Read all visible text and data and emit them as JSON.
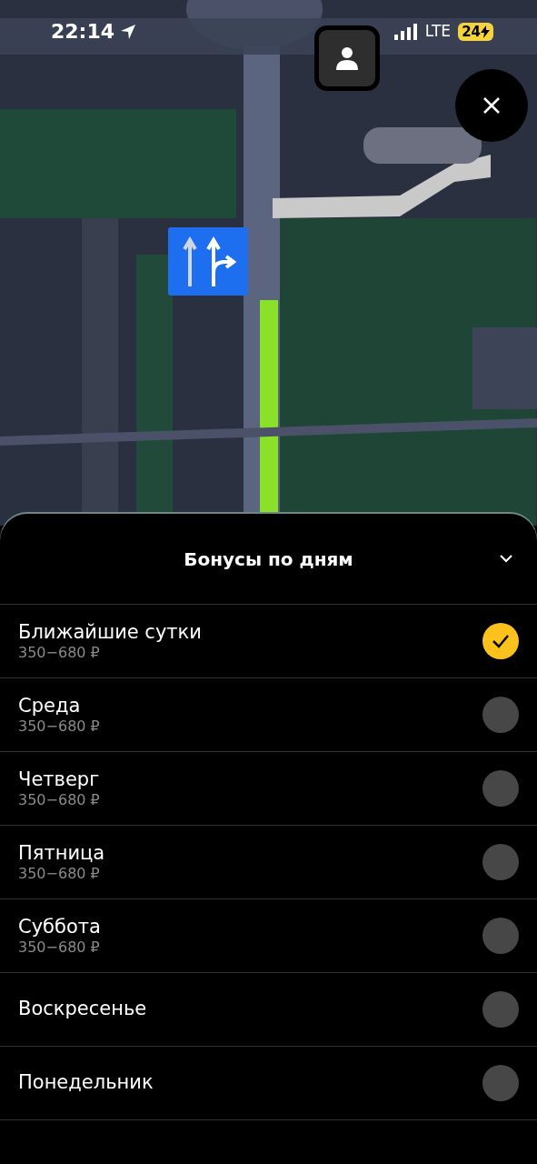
{
  "status_bar": {
    "time": "22:14",
    "network": "LTE",
    "battery": "24"
  },
  "sheet": {
    "title": "Бонусы по дням",
    "expanded": true,
    "options": [
      {
        "name": "Ближайшие сутки",
        "price": "350−680 ₽",
        "selected": true
      },
      {
        "name": "Среда",
        "price": "350−680 ₽",
        "selected": false
      },
      {
        "name": "Четверг",
        "price": "350−680 ₽",
        "selected": false
      },
      {
        "name": "Пятница",
        "price": "350−680 ₽",
        "selected": false
      },
      {
        "name": "Суббота",
        "price": "350−680 ₽",
        "selected": false
      },
      {
        "name": "Воскресенье",
        "selected": false
      },
      {
        "name": "Понедельник",
        "selected": false
      }
    ]
  }
}
